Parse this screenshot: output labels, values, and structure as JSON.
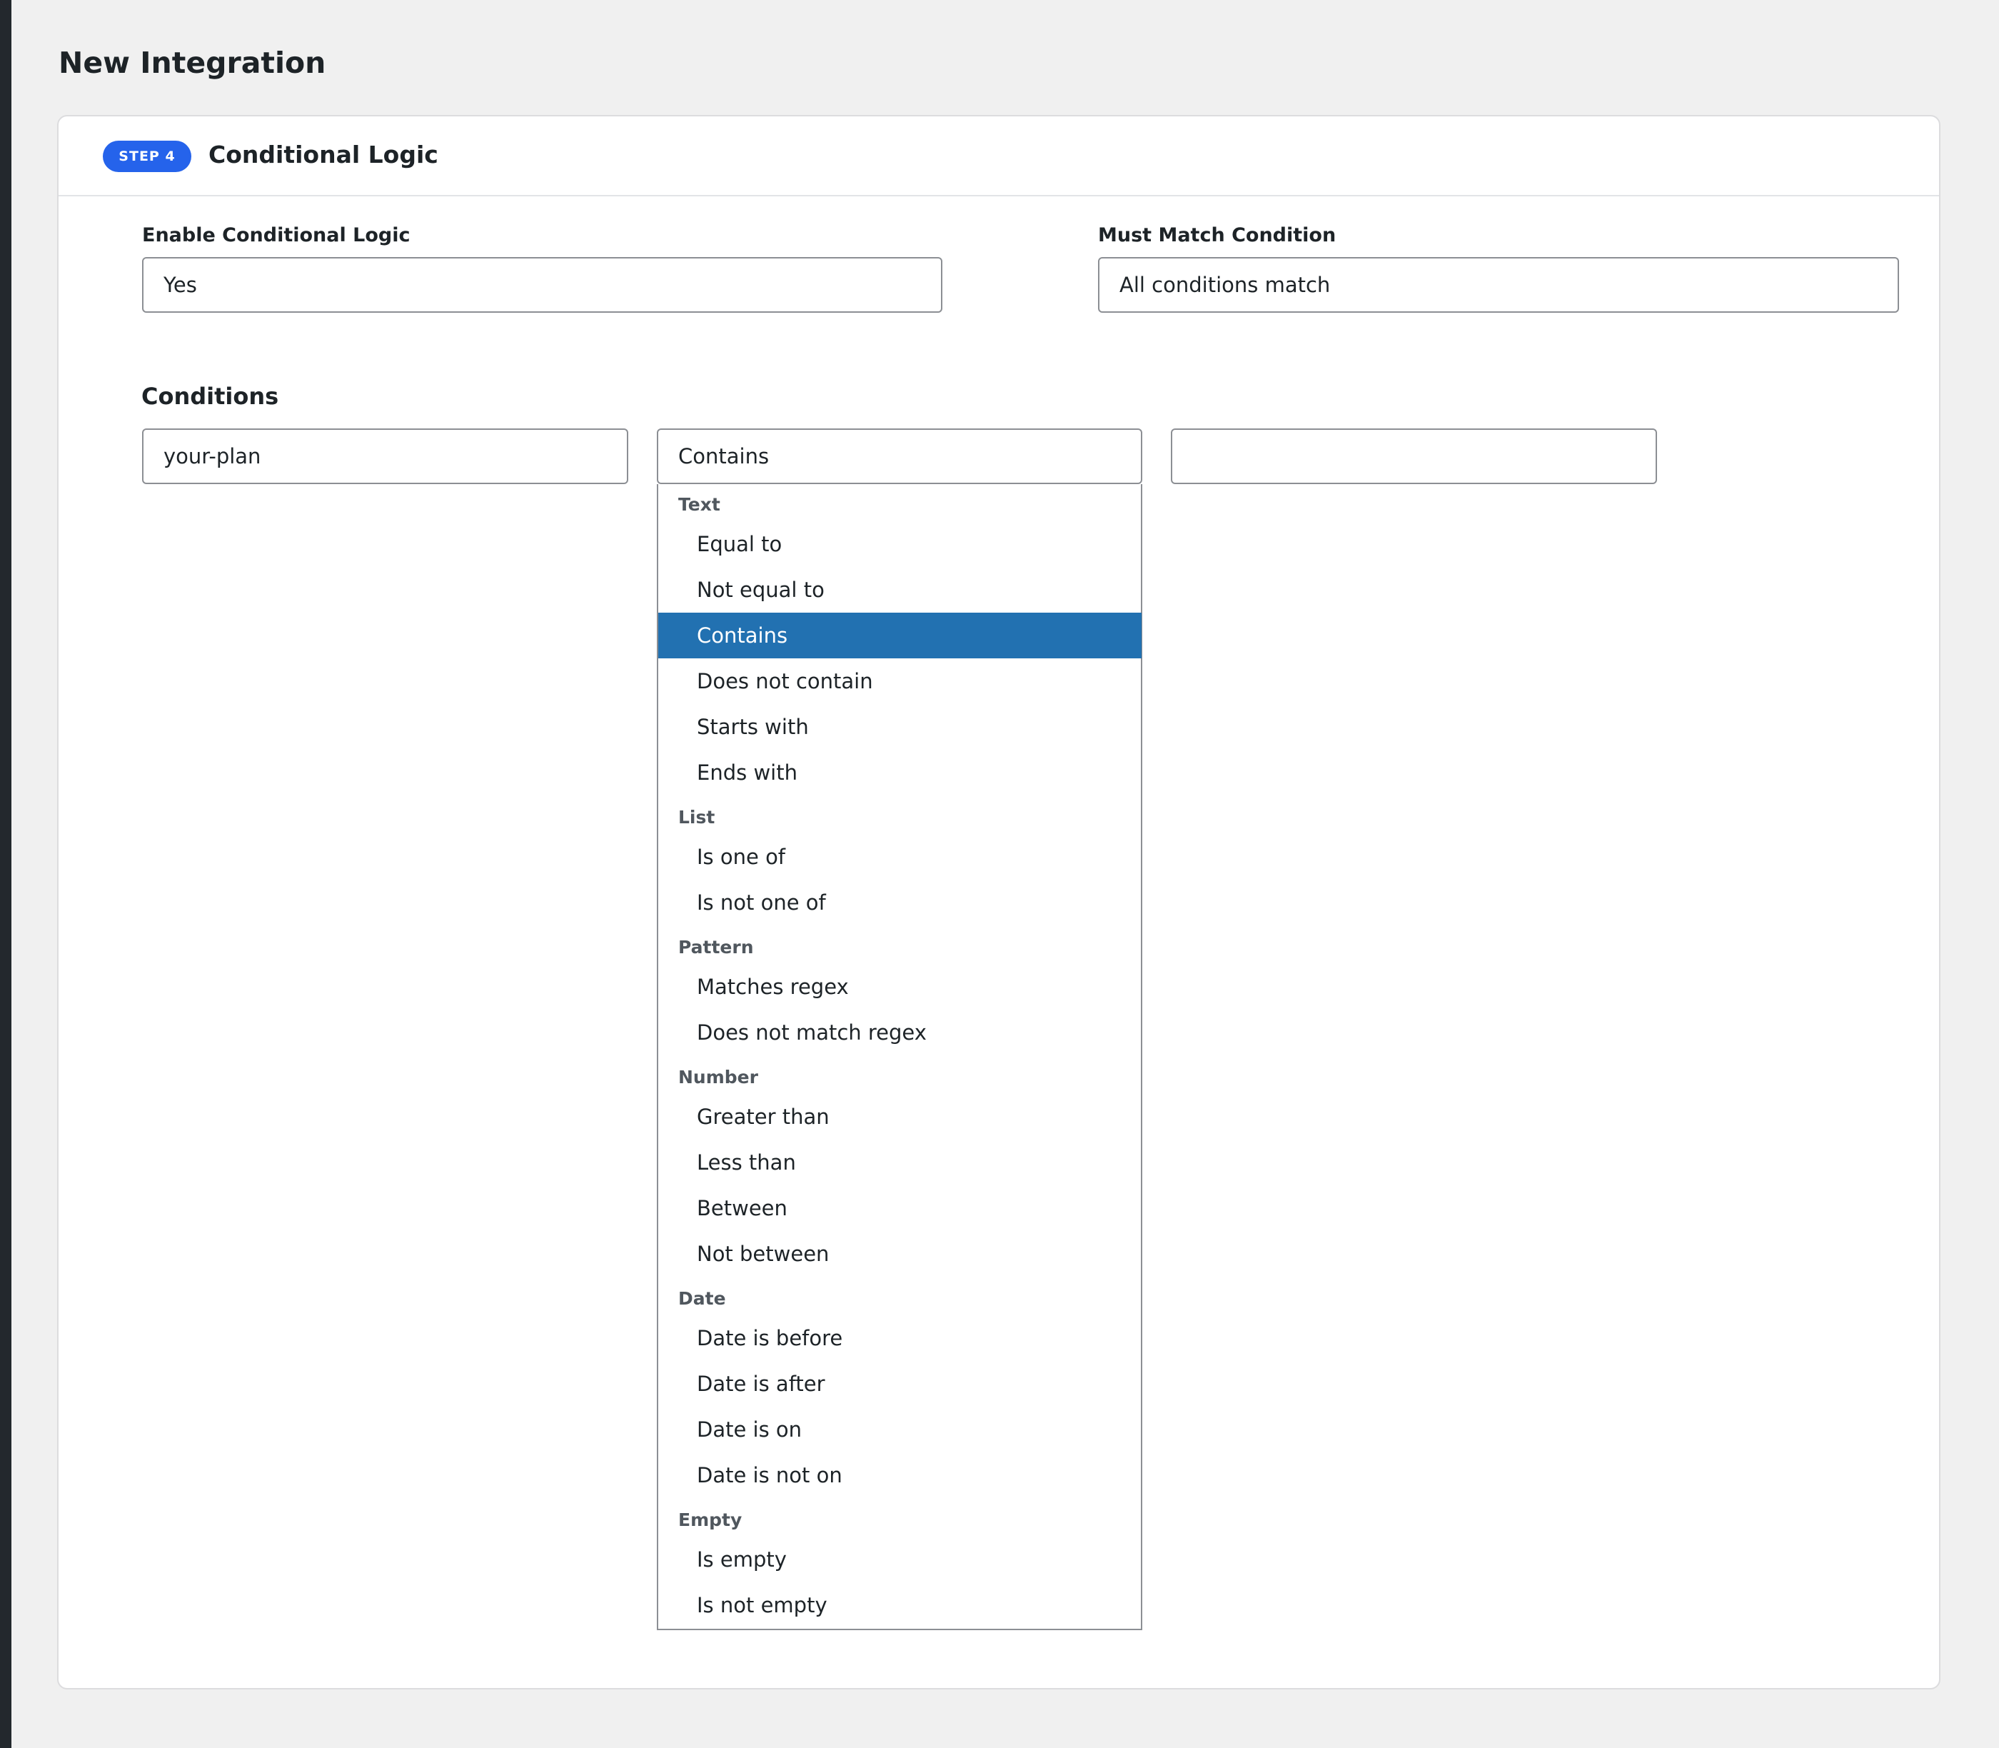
{
  "page": {
    "title": "New Integration"
  },
  "step": {
    "badge": "STEP 4",
    "title": "Conditional Logic"
  },
  "fields": {
    "enable_conditional_logic": {
      "label": "Enable Conditional Logic",
      "value": "Yes"
    },
    "must_match_condition": {
      "label": "Must Match Condition",
      "value": "All conditions match"
    }
  },
  "conditions": {
    "label": "Conditions",
    "row": {
      "field": "your-plan",
      "operator": "Contains",
      "value": ""
    }
  },
  "operator_dropdown": {
    "selected": "Contains",
    "groups": [
      {
        "label": "Text",
        "options": [
          "Equal to",
          "Not equal to",
          "Contains",
          "Does not contain",
          "Starts with",
          "Ends with"
        ]
      },
      {
        "label": "List",
        "options": [
          "Is one of",
          "Is not one of"
        ]
      },
      {
        "label": "Pattern",
        "options": [
          "Matches regex",
          "Does not match regex"
        ]
      },
      {
        "label": "Number",
        "options": [
          "Greater than",
          "Less than",
          "Between",
          "Not between"
        ]
      },
      {
        "label": "Date",
        "options": [
          "Date is before",
          "Date is after",
          "Date is on",
          "Date is not on"
        ]
      },
      {
        "label": "Empty",
        "options": [
          "Is empty",
          "Is not empty"
        ]
      }
    ]
  },
  "colors": {
    "badge": "#2563eb",
    "selected_option": "#2271b1",
    "page_background": "#f0f0f0"
  }
}
